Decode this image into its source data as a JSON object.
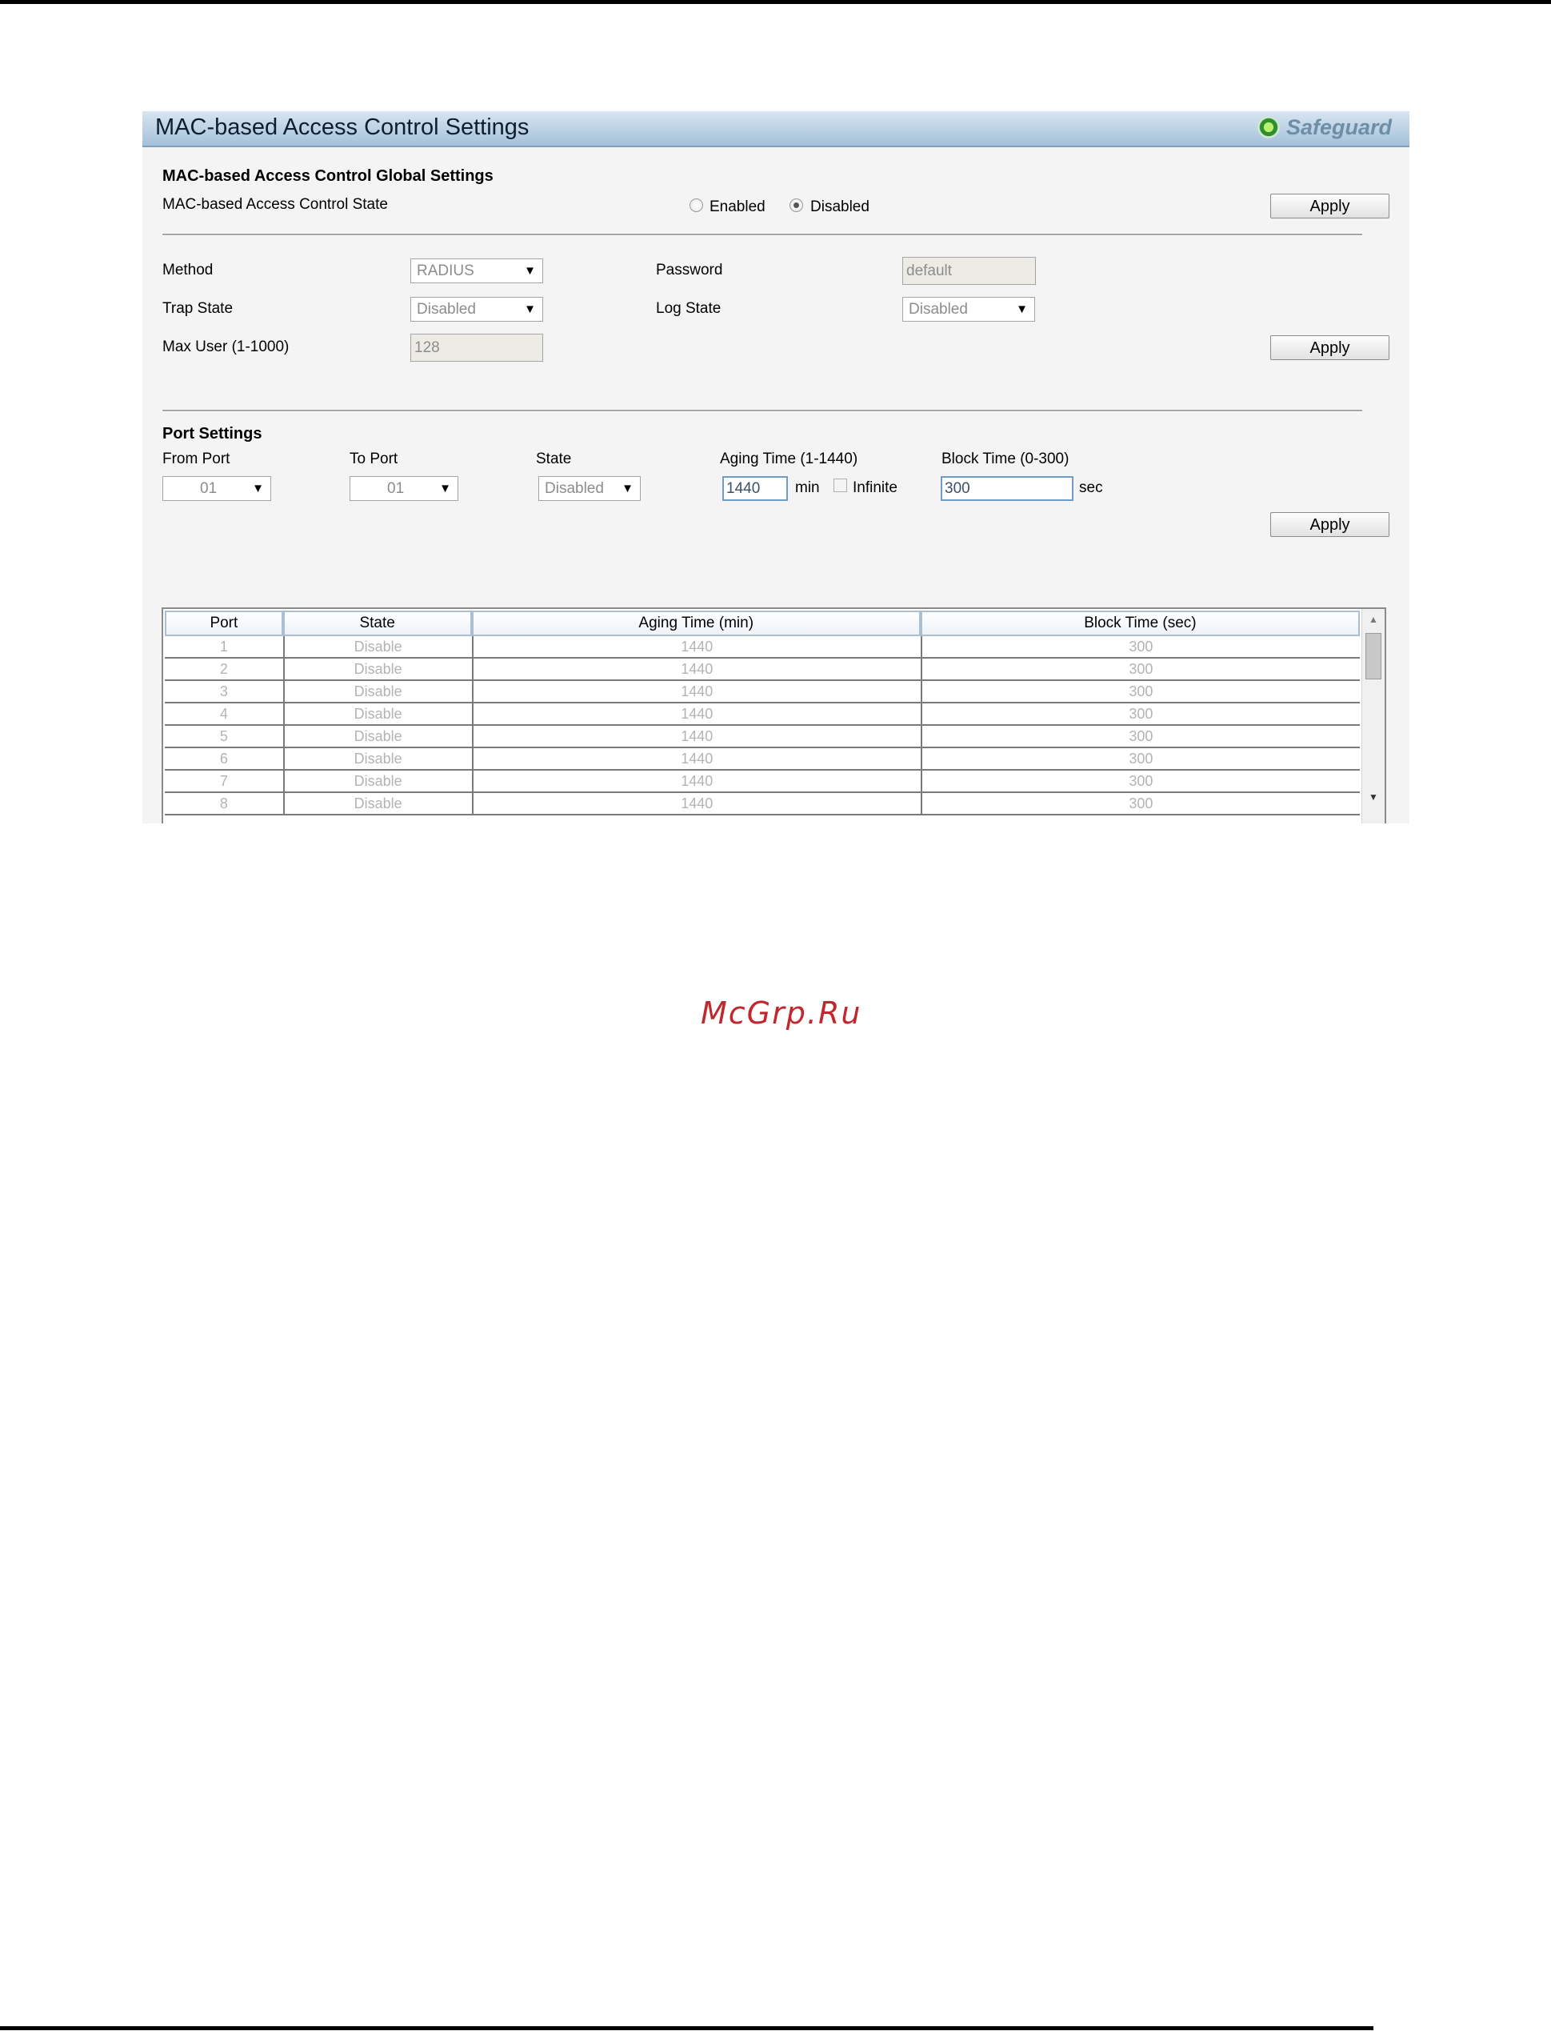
{
  "page": {
    "title": "MAC-based Access Control Settings",
    "safeguard_label": "Safeguard",
    "watermark": "McGrp.Ru"
  },
  "global": {
    "heading": "MAC-based Access Control Global Settings",
    "state_label": "MAC-based Access Control State",
    "enabled_label": "Enabled",
    "disabled_label": "Disabled",
    "selected": "Disabled",
    "apply_label": "Apply"
  },
  "config": {
    "method_label": "Method",
    "method_value": "RADIUS",
    "password_label": "Password",
    "password_value": "default",
    "trap_state_label": "Trap State",
    "trap_state_value": "Disabled",
    "log_state_label": "Log State",
    "log_state_value": "Disabled",
    "max_user_label": "Max User (1-1000)",
    "max_user_value": "128",
    "apply_label": "Apply"
  },
  "port_settings": {
    "heading": "Port Settings",
    "from_port_label": "From Port",
    "from_port_value": "01",
    "to_port_label": "To Port",
    "to_port_value": "01",
    "state_label": "State",
    "state_value": "Disabled",
    "aging_label": "Aging Time (1-1440)",
    "aging_value": "1440",
    "aging_unit": "min",
    "infinite_label": "Infinite",
    "block_label": "Block Time (0-300)",
    "block_value": "300",
    "block_unit": "sec",
    "apply_label": "Apply"
  },
  "table": {
    "columns": [
      "Port",
      "State",
      "Aging Time (min)",
      "Block Time (sec)"
    ],
    "rows": [
      [
        "1",
        "Disable",
        "1440",
        "300"
      ],
      [
        "2",
        "Disable",
        "1440",
        "300"
      ],
      [
        "3",
        "Disable",
        "1440",
        "300"
      ],
      [
        "4",
        "Disable",
        "1440",
        "300"
      ],
      [
        "5",
        "Disable",
        "1440",
        "300"
      ],
      [
        "6",
        "Disable",
        "1440",
        "300"
      ],
      [
        "7",
        "Disable",
        "1440",
        "300"
      ],
      [
        "8",
        "Disable",
        "1440",
        "300"
      ]
    ]
  },
  "icons": {
    "safeguard": "safeguard-status-icon",
    "dropdown": "chevron-down-icon",
    "scroll_up": "scroll-up-icon",
    "scroll_down": "scroll-down-icon"
  }
}
